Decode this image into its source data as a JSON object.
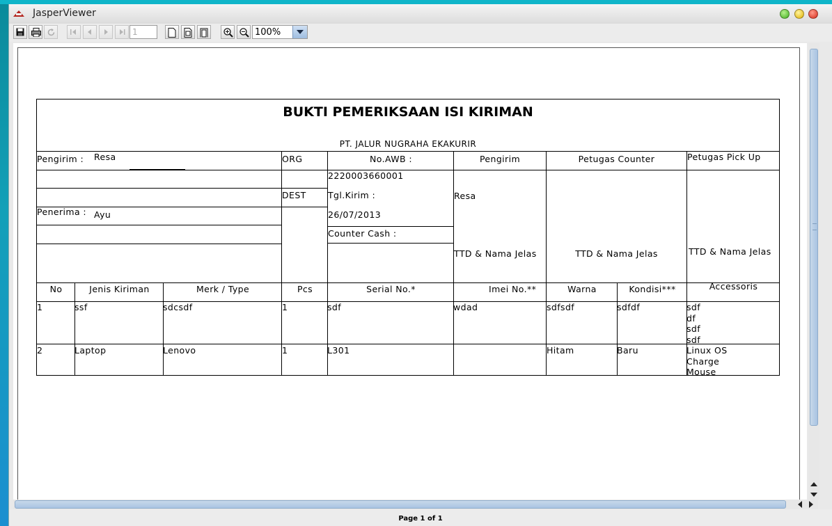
{
  "window": {
    "title": "JasperViewer"
  },
  "toolbar": {
    "page_number": "1",
    "zoom": "100%"
  },
  "status": {
    "page_info": "Page 1 of 1"
  },
  "report": {
    "title": "BUKTI PEMERIKSAAN ISI KIRIMAN",
    "company": "PT. JALUR NUGRAHA EKAKURIR",
    "labels": {
      "pengirim": "Pengirim :",
      "penerima": "Penerima :",
      "org": "ORG",
      "dest": "DEST",
      "no_awb": "No.AWB :",
      "tgl_kirim": "Tgl.Kirim :",
      "counter_cash": "Counter Cash :",
      "col_pengirim": "Pengirim",
      "col_petugas_counter": "Petugas Counter",
      "col_petugas_pickup": "Petugas Pick Up",
      "ttd1": "TTD & Nama Jelas",
      "ttd2": "TTD & Nama Jelas",
      "ttd3": "TTD & Nama Jelas"
    },
    "values": {
      "pengirim_name": "Resa",
      "penerima_name": "Ayu",
      "awb_number": "2220003660001",
      "tgl_kirim": "26/07/2013",
      "sign_pengirim": "Resa"
    },
    "items_headers": [
      "No",
      "Jenis Kiriman",
      "Merk / Type",
      "Pcs",
      "Serial No.*",
      "Imei No.**",
      "Warna",
      "Kondisi***",
      "Accessoris"
    ],
    "items": [
      {
        "no": "1",
        "jenis": "ssf",
        "merk": "sdcsdf",
        "pcs": "1",
        "serial": "sdf",
        "imei": "wdad",
        "warna": "sdfsdf",
        "kondisi": "sdfdf",
        "accessoris": [
          "sdf",
          "df",
          "sdf",
          "sdf"
        ]
      },
      {
        "no": "2",
        "jenis": "Laptop",
        "merk": "Lenovo",
        "pcs": "1",
        "serial": "L301",
        "imei": "",
        "warna": "Hitam",
        "kondisi": "Baru",
        "accessoris": [
          "Linux OS",
          "Charge",
          "Mouse"
        ]
      }
    ]
  }
}
